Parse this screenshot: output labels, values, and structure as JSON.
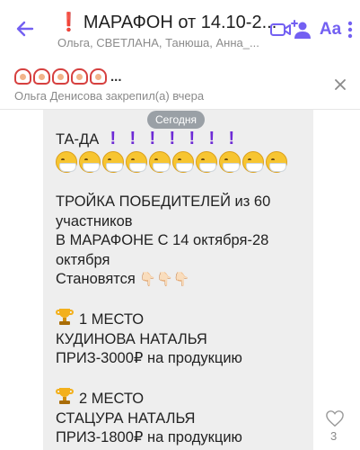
{
  "header": {
    "title_mark": "❗",
    "title": "МАРАФОН от 14.10-2...",
    "members": "Ольга, СВЕТЛАНА, Танюша, Анна_..."
  },
  "pinned": {
    "dots": "...",
    "subtitle": "Ольга Денисова закрепил(а) вчера"
  },
  "chat": {
    "date": "Сегодня",
    "message": {
      "line1": "ТА-ДА",
      "line2": "ТРОЙКА ПОБЕДИТЕЛЕЙ из 60",
      "line3": "участников",
      "line4": "В МАРАФОНЕ С 14 октября-28",
      "line5": "октября",
      "line6": "Становятся",
      "place1": "1 МЕСТО",
      "winner1": "КУДИНОВА НАТАЛЬЯ",
      "prize1": "ПРИЗ-3000₽ на продукцию",
      "place2": "2 МЕСТО",
      "winner2": "СТАЦУРА НАТАЛЬЯ",
      "prize2": "ПРИЗ-1800₽ на продукцию"
    },
    "likes": "3"
  },
  "icons": {
    "exclaim": "❕",
    "point_down": "👇🏻"
  },
  "colors": {
    "accent": "#7360f2",
    "bubble": "#eeeeee",
    "title_mark": "#e0142b",
    "date_pill": "#9aa0a6",
    "exclaim": "#6e2bd6"
  }
}
